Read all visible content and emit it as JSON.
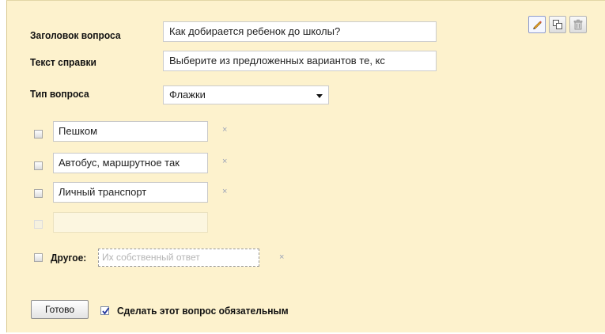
{
  "form": {
    "title_label": "Заголовок вопроса",
    "title_value": "Как добирается ребенок до школы?",
    "help_label": "Текст справки",
    "help_value": "Выберите из предложенных вариантов те, кс",
    "type_label": "Тип вопроса",
    "type_value": "Флажки"
  },
  "options": [
    {
      "label": "Пешком"
    },
    {
      "label": "Автобус, маршрутное так"
    },
    {
      "label": "Личный транспорт"
    }
  ],
  "other": {
    "label": "Другое:",
    "placeholder": "Их собственный ответ"
  },
  "remove_glyph": "×",
  "footer": {
    "done_label": "Готово",
    "required_label": "Сделать этот вопрос обязательным",
    "required_checked": true
  },
  "toolbar": {
    "icons": [
      "pencil-icon",
      "copy-icon",
      "trash-icon"
    ]
  },
  "colors": {
    "panel_bg": "#fdf2cd",
    "accent": "#7f8da8"
  }
}
